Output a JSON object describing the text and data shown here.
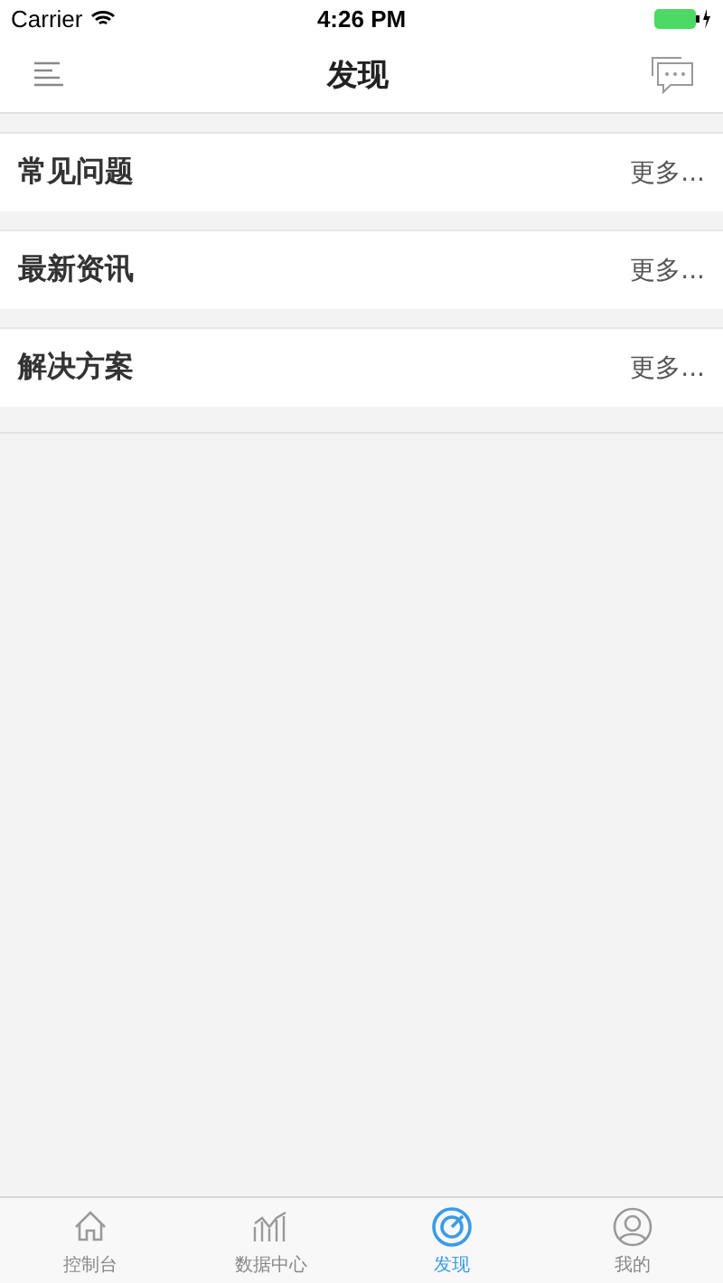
{
  "status_bar": {
    "carrier": "Carrier",
    "time": "4:26 PM"
  },
  "nav_bar": {
    "title": "发现"
  },
  "sections": [
    {
      "title": "常见问题",
      "more": "更多..."
    },
    {
      "title": "最新资讯",
      "more": "更多..."
    },
    {
      "title": "解决方案",
      "more": "更多..."
    }
  ],
  "tab_bar": [
    {
      "label": "控制台",
      "selected": false
    },
    {
      "label": "数据中心",
      "selected": false
    },
    {
      "label": "发现",
      "selected": true
    },
    {
      "label": "我的",
      "selected": false
    }
  ]
}
